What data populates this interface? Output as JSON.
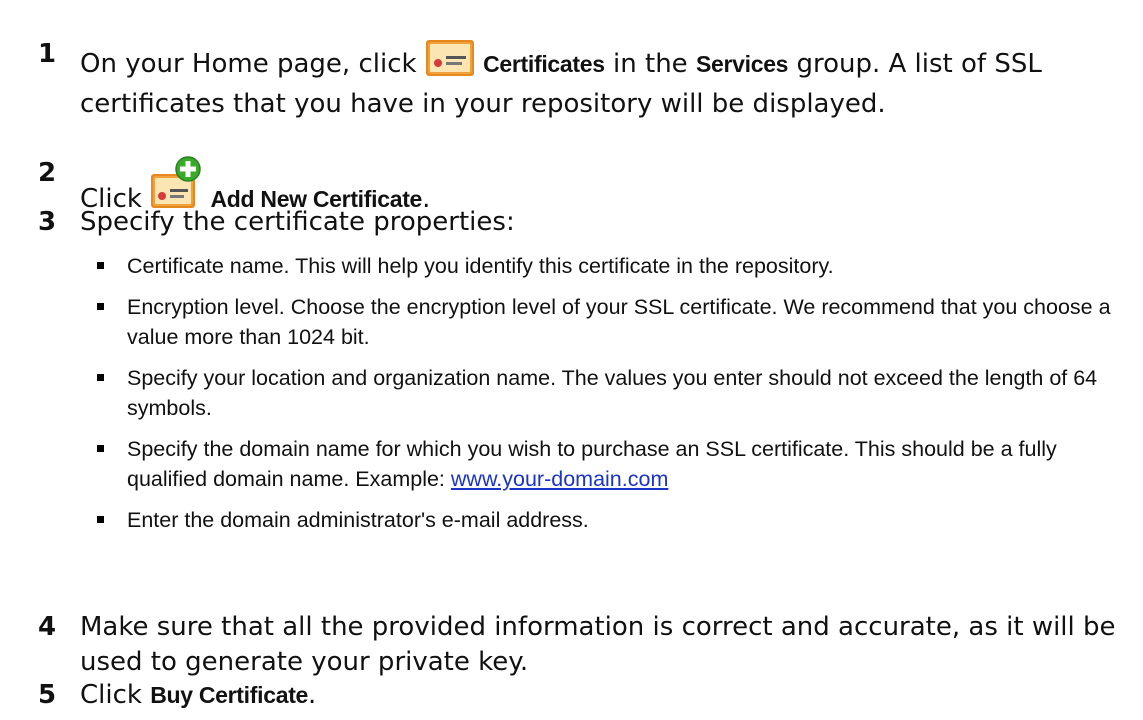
{
  "steps": [
    {
      "number": "1",
      "text_before": "On your Home page, click ",
      "ui_label": "Certificates",
      "text_middle": " in the ",
      "group_label": "Services",
      "text_after": " group. A list of SSL certificates that you have in your repository will be displayed.",
      "icon": "certificate-icon"
    },
    {
      "number": "2",
      "text_before": "Click ",
      "ui_label": "Add New Certificate",
      "text_after": ".",
      "icon": "add-certificate-icon"
    },
    {
      "number": "3",
      "text": "Specify the certificate properties:"
    },
    {
      "number": "4",
      "text": "Make sure that all the provided information is correct and accurate, as it will be used to generate your private key."
    },
    {
      "number": "5",
      "text_before": "Click ",
      "ui_label": "Buy Certificate",
      "text_after": "."
    }
  ],
  "bullets": [
    {
      "text": "Certificate name. This will help you identify this certificate in the repository."
    },
    {
      "text": "Encryption level. Choose the encryption level of your SSL certificate. We recommend that you choose a value more than 1024 bit."
    },
    {
      "text": "Specify your location and organization name. The values you enter should not exceed the length of 64 symbols."
    },
    {
      "text": "Specify the domain name for which you wish to purchase an SSL certificate. This should be a fully qualified domain name. Example: ",
      "link": "www.your-domain.com"
    },
    {
      "text": "Enter the domain administrator's e-mail address."
    }
  ],
  "colors": {
    "text": "#111111",
    "link": "#1a33c8",
    "certificate_orange": "#f0a23a",
    "certificate_paper": "#fbe6b3",
    "plus_green": "#3aaa2a"
  }
}
